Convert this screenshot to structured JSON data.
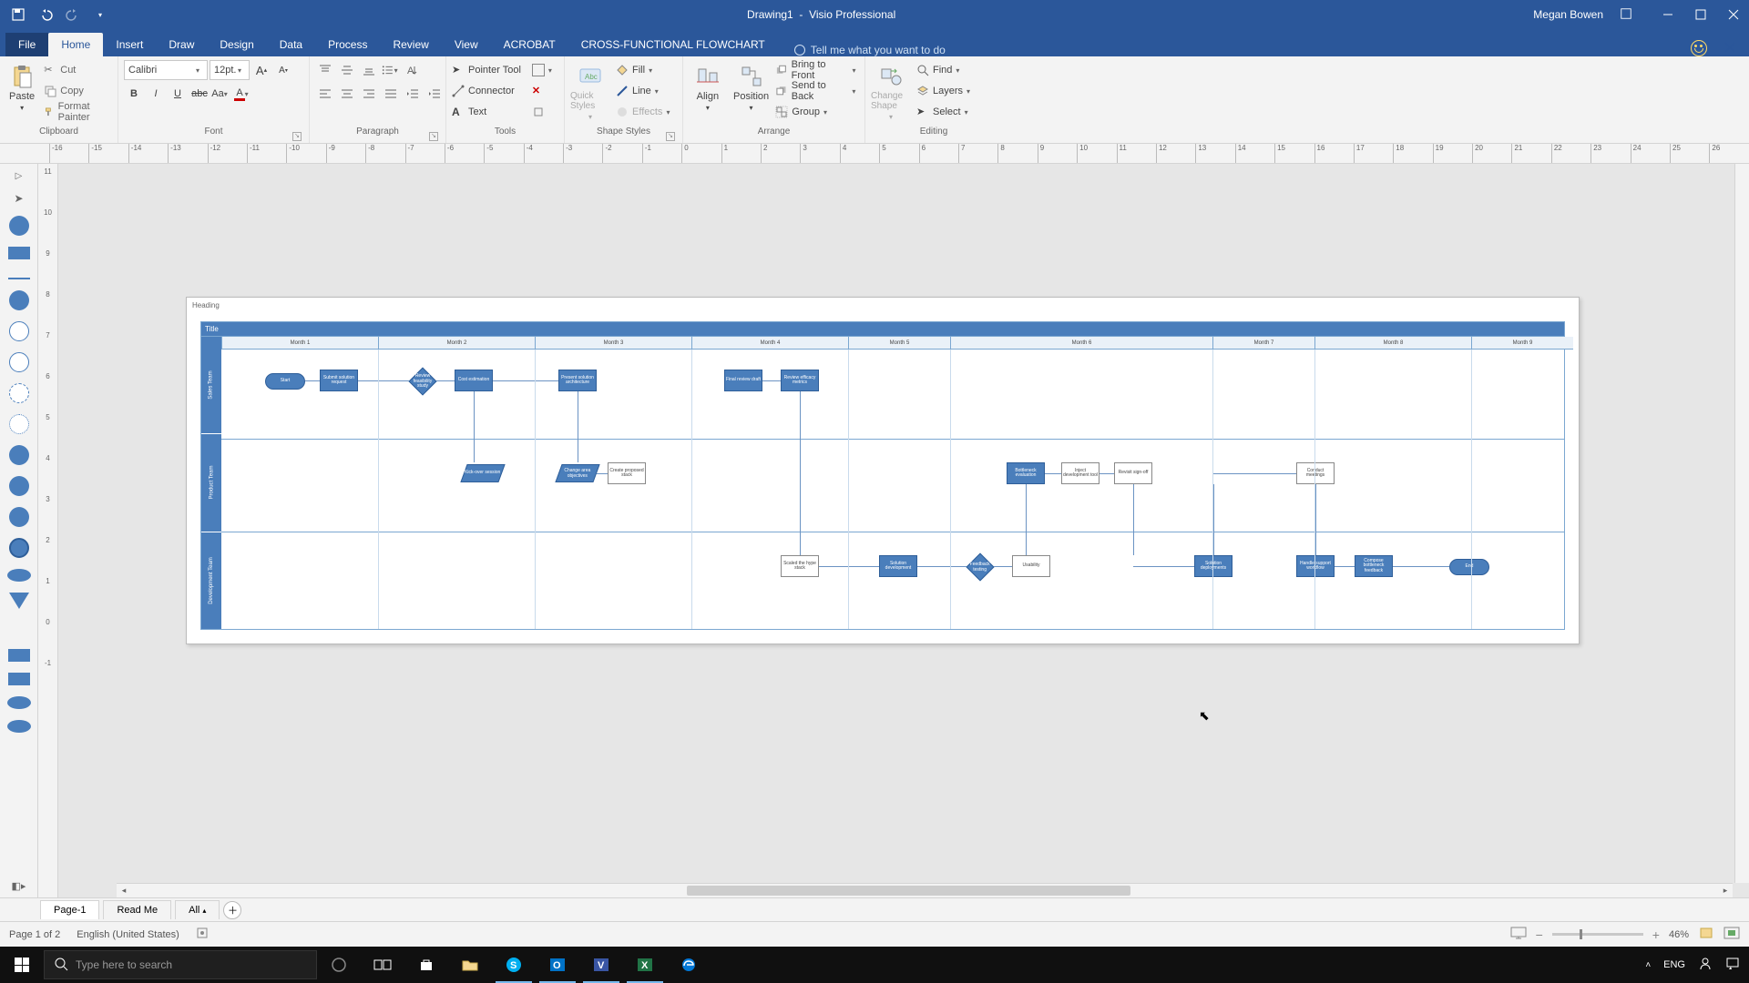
{
  "titlebar": {
    "doc": "Drawing1",
    "app": "Visio Professional",
    "user": "Megan Bowen"
  },
  "tabs": {
    "file": "File",
    "home": "Home",
    "insert": "Insert",
    "draw": "Draw",
    "design": "Design",
    "data": "Data",
    "process": "Process",
    "review": "Review",
    "view": "View",
    "acrobat": "ACROBAT",
    "cff": "CROSS-FUNCTIONAL FLOWCHART",
    "tellme": "Tell me what you want to do"
  },
  "ribbon": {
    "clipboard": {
      "label": "Clipboard",
      "paste": "Paste",
      "cut": "Cut",
      "copy": "Copy",
      "fmt": "Format Painter"
    },
    "font": {
      "label": "Font",
      "name": "Calibri",
      "size": "12pt."
    },
    "paragraph": {
      "label": "Paragraph"
    },
    "tools": {
      "label": "Tools",
      "pointer": "Pointer Tool",
      "connector": "Connector",
      "text": "Text"
    },
    "shapestyles": {
      "label": "Shape Styles",
      "quick": "Quick Styles",
      "fill": "Fill",
      "line": "Line",
      "effects": "Effects"
    },
    "arrange": {
      "label": "Arrange",
      "align": "Align",
      "position": "Position",
      "front": "Bring to Front",
      "back": "Send to Back",
      "group": "Group"
    },
    "editing": {
      "label": "Editing",
      "change": "Change Shape",
      "find": "Find",
      "layers": "Layers",
      "select": "Select"
    }
  },
  "ruler_h": [
    "-16",
    "-15",
    "-14",
    "-13",
    "-12",
    "-11",
    "-10",
    "-9",
    "-8",
    "-7",
    "-6",
    "-5",
    "-4",
    "-3",
    "-2",
    "-1",
    "0",
    "1",
    "2",
    "3",
    "4",
    "5",
    "6",
    "7",
    "8",
    "9",
    "10",
    "11",
    "12",
    "13",
    "14",
    "15",
    "16",
    "17",
    "18",
    "19",
    "20",
    "21",
    "22",
    "23",
    "24",
    "25",
    "26"
  ],
  "ruler_v": [
    "11",
    "10",
    "9",
    "8",
    "7",
    "6",
    "5",
    "4",
    "3",
    "2",
    "1",
    "0",
    "-1"
  ],
  "flowchart": {
    "heading": "Heading",
    "title": "Title",
    "phases": [
      "Month 1",
      "Month 2",
      "Month 3",
      "Month 4",
      "Month 5",
      "Month 6",
      "Month 7",
      "Month 8",
      "Month 9"
    ],
    "lanes": [
      "Sales Team",
      "Product Team",
      "Development Team"
    ],
    "shapes": {
      "s1": "Start",
      "s2": "Submit solution request",
      "s3": "Review feasibility study",
      "s4": "Cost estimation",
      "s5": "Present solution architecture",
      "s6": "Final review draft",
      "s7": "Review efficacy metrics",
      "p1": "Kick-over session",
      "p2": "Change area objectives",
      "p3": "Create proposed stack",
      "p4": "Bottleneck evaluation",
      "p5": "Inject development tool",
      "p6": "Revisit sign-off",
      "p7": "Conduct meetings",
      "d1": "Scaled the hype stack",
      "d2": "Solution development",
      "d3": "Feedback testing",
      "d4": "Usability",
      "d5": "Solution deployments",
      "d6": "Handle support workflow",
      "d7": "Compose bottleneck feedback",
      "d8": "End"
    }
  },
  "pagetabs": {
    "p1": "Page-1",
    "p2": "Read Me",
    "p3": "All"
  },
  "status": {
    "page": "Page 1 of 2",
    "lang": "English (United States)",
    "zoom": "46%"
  },
  "taskbar": {
    "search": "Type here to search",
    "lang": "ENG"
  }
}
